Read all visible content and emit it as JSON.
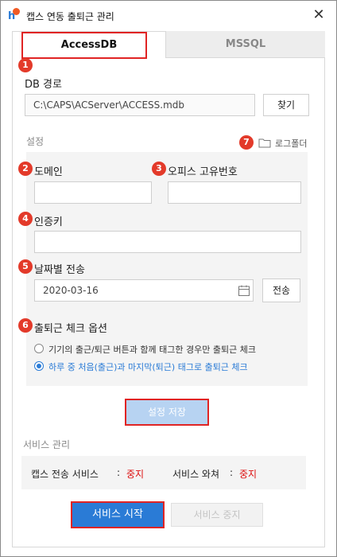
{
  "window": {
    "title": "캡스 연동 출퇴근 관리",
    "close_glyph": "✕"
  },
  "tabs": [
    {
      "label": "AccessDB",
      "active": true
    },
    {
      "label": "MSSQL",
      "active": false
    }
  ],
  "badges": [
    "1",
    "2",
    "3",
    "4",
    "5",
    "6",
    "7"
  ],
  "db": {
    "label": "DB 경로",
    "path_value": "C:\\CAPS\\ACServer\\ACCESS.mdb",
    "browse_label": "찾기"
  },
  "settings": {
    "section_label": "설정",
    "log_folder_label": "로그폴더",
    "domain_label": "도메인",
    "domain_value": "",
    "office_id_label": "오피스 고유번호",
    "office_id_value": "",
    "auth_key_label": "인증키",
    "auth_key_value": "",
    "date_send_label": "날짜별 전송",
    "date_value": "2020-03-16",
    "send_label": "전송",
    "option_label": "출퇴근 체크 옵션",
    "options": [
      {
        "label": "기기의 출근/퇴근 버튼과 함께 태그한 경우만 출퇴근 체크",
        "checked": false
      },
      {
        "label": "하루 중 처음(출근)과 마지막(퇴근) 태그로 출퇴근 체크",
        "checked": true
      }
    ],
    "save_label": "설정 저장"
  },
  "service": {
    "section_label": "서비스 관리",
    "caps_service_label": "캡스 전송 서비스",
    "caps_service_sep": ":",
    "caps_service_status": "중지",
    "watcher_label": "서비스 와쳐",
    "watcher_sep": ":",
    "watcher_status": "중지",
    "start_label": "서비스 시작",
    "stop_label": "서비스 중지"
  },
  "colors": {
    "accent": "#2a7bd6",
    "badge": "#e33a2a",
    "highlight": "#e02424",
    "status_stopped": "#dd1111"
  },
  "icons": [
    "app-logo-icon",
    "close-icon",
    "folder-icon",
    "calendar-icon"
  ]
}
